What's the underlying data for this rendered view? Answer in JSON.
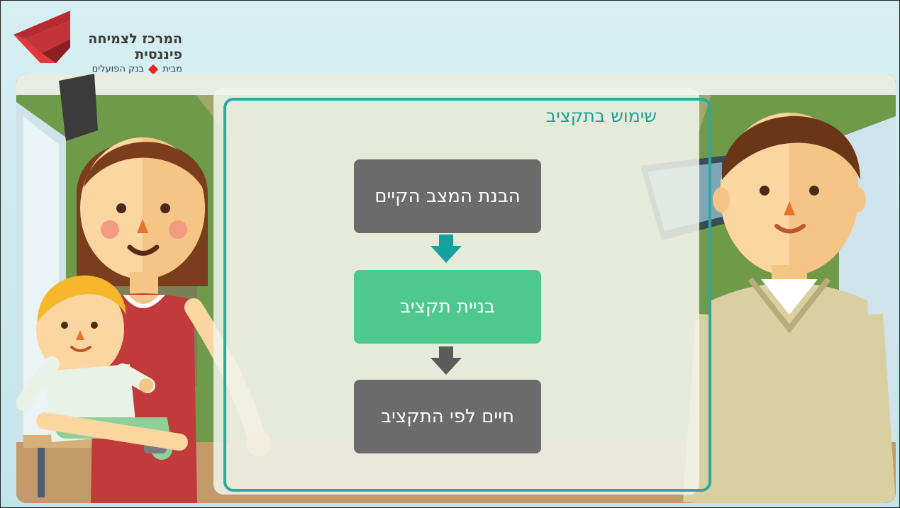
{
  "brand": {
    "title": "המרכז לצמיחה פיננסית",
    "subtitle_prefix": "מבית",
    "subtitle_suffix": "בנק הפועלים",
    "colors": {
      "logo_red": "#e03a3e",
      "diamond": "#ee2222"
    }
  },
  "panel": {
    "title": "שימוש בתקציב",
    "accent": "#17a39a"
  },
  "steps": [
    {
      "label": "הבנת המצב הקיים",
      "color": "#6b6b6b"
    },
    {
      "label": "בניית תקציב",
      "color": "#4fc88e"
    },
    {
      "label": "חיים לפי התקציב",
      "color": "#6b6b6b"
    }
  ],
  "arrows": [
    {
      "icon": "arrow-down-icon",
      "color": "#16a29c"
    },
    {
      "icon": "arrow-down-icon",
      "color": "#5c5c5c"
    }
  ],
  "characters": [
    "woman",
    "child",
    "man"
  ]
}
